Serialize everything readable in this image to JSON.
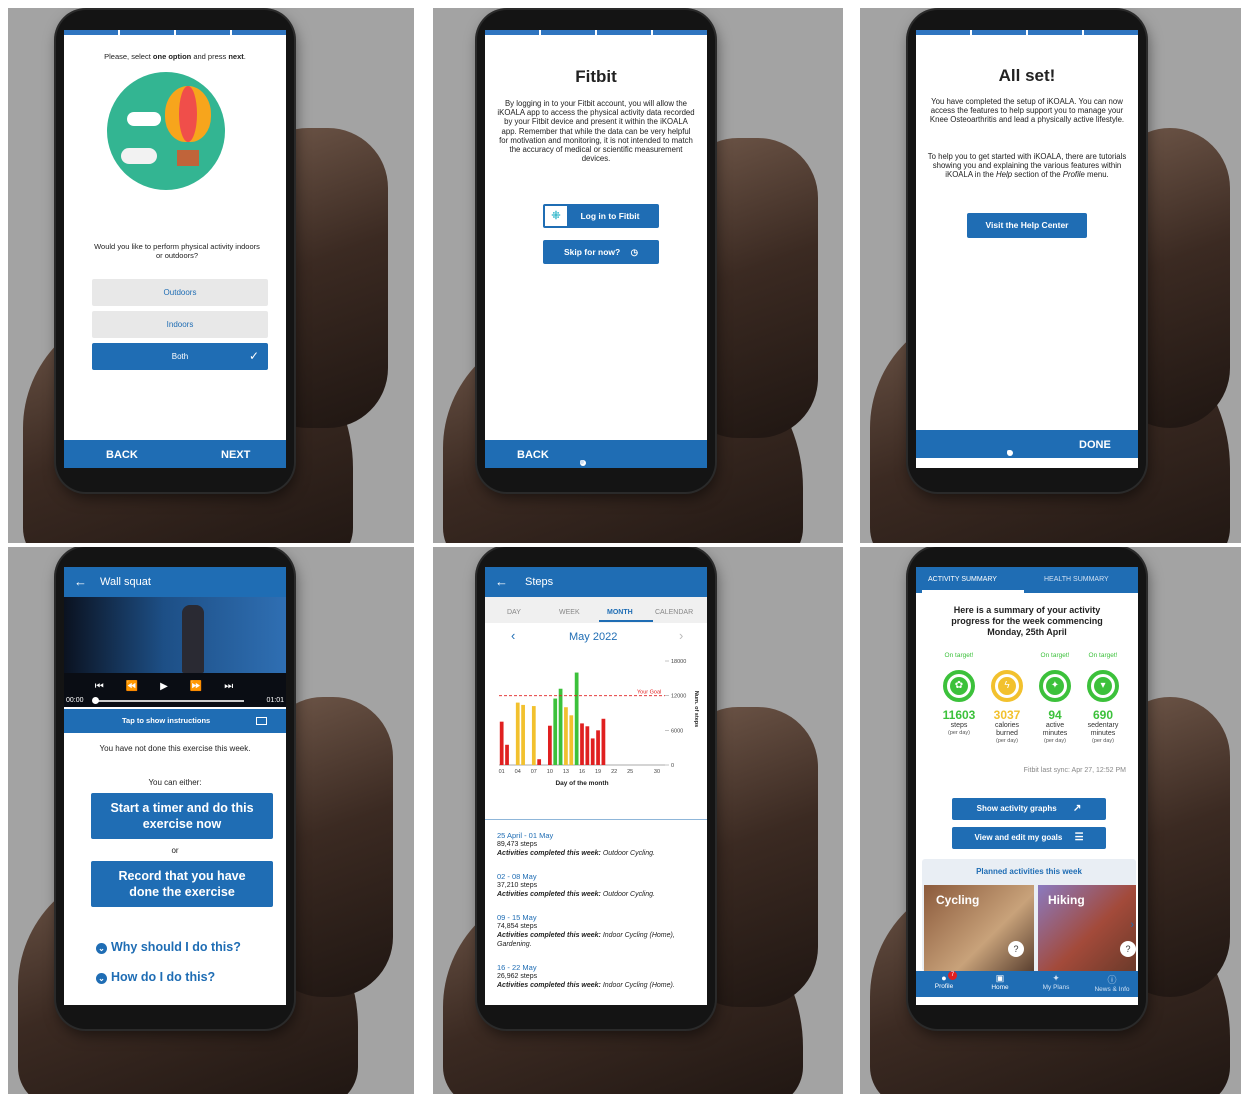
{
  "screen1": {
    "instruction_pre": "Please, select ",
    "instruction_b1": "one option",
    "instruction_mid": " and press ",
    "instruction_b2": "next",
    "instruction_post": ".",
    "question": "Would you like to perform physical activity indoors or outdoors?",
    "options": [
      "Outdoors",
      "Indoors",
      "Both"
    ],
    "selected_check": "✓",
    "back": "BACK",
    "next": "NEXT"
  },
  "screen2": {
    "title": "Fitbit",
    "body": "By logging in to your Fitbit account, you will allow the iKOALA app to access the physical activity data recorded by your Fitbit device and present it within the iKOALA app. Remember that while the data can be very helpful for motivation and monitoring, it is not intended to match the accuracy of medical or scientific measurement devices.",
    "login_button": "Log in to Fitbit",
    "skip_button": "Skip for now?",
    "back": "BACK"
  },
  "screen3": {
    "title": "All set!",
    "para1": "You have completed the setup of iKOALA. You can now access the features to help support you to manage your Knee Osteoarthritis and lead a physically active lifestyle.",
    "para2_a": "To help you to get started with iKOALA, there are tutorials showing you and explaining the various features within iKOALA in the ",
    "para2_help": "Help",
    "para2_b": " section of the ",
    "para2_profile": "Profile",
    "para2_c": " menu.",
    "help_button": "Visit the Help Center",
    "done": "DONE"
  },
  "screen4": {
    "title": "Wall squat",
    "time_start": "00:00",
    "time_end": "01:01",
    "instructions_bar": "Tap to show instructions",
    "not_done": "You have not done this exercise this week.",
    "can_either": "You can either:",
    "btn_timer": "Start a timer and do this exercise now",
    "or": "or",
    "btn_record": "Record that you have done the exercise",
    "why": "Why should I do this?",
    "how": "How do I do this?"
  },
  "screen5": {
    "title": "Steps",
    "tabs": [
      "DAY",
      "WEEK",
      "MONTH",
      "CALENDAR"
    ],
    "active_tab": "MONTH",
    "month": "May 2022",
    "goal_label": "Your Goal",
    "xlabel": "Day of the month",
    "ylabel": "Num. of steps",
    "weeks": [
      {
        "dates": "25 April - 01 May",
        "steps": "89,473 steps",
        "label": "Activities completed this week:",
        "acts": " Outdoor Cycling."
      },
      {
        "dates": "02 - 08 May",
        "steps": "37,210 steps",
        "label": "Activities completed this week:",
        "acts": " Outdoor Cycling."
      },
      {
        "dates": "09 - 15 May",
        "steps": "74,854 steps",
        "label": "Activities completed this week:",
        "acts": " Indoor Cycling (Home), Gardening."
      },
      {
        "dates": "16 - 22 May",
        "steps": "26,962 steps",
        "label": "Activities completed this week:",
        "acts": " Indoor Cycling (Home)."
      }
    ]
  },
  "chart_data": {
    "type": "bar",
    "x": [
      1,
      2,
      3,
      4,
      5,
      6,
      7,
      8,
      9,
      10,
      11,
      12,
      13,
      14,
      15,
      16,
      17,
      18,
      19,
      20,
      21,
      22,
      23,
      24,
      25,
      26,
      27,
      28,
      29,
      30,
      31
    ],
    "values": [
      7500,
      3500,
      0,
      10800,
      10400,
      0,
      10200,
      1000,
      0,
      6800,
      11500,
      13200,
      10000,
      8600,
      16000,
      7200,
      6700,
      4600,
      6000,
      8000,
      0,
      0,
      0,
      0,
      0,
      0,
      0,
      0,
      0,
      0,
      0
    ],
    "colors": [
      "#e02020",
      "#e02020",
      "#e02020",
      "#f2c12e",
      "#f2c12e",
      "#e02020",
      "#f2c12e",
      "#e02020",
      "#e02020",
      "#e02020",
      "#3cc13b",
      "#3cc13b",
      "#f2c12e",
      "#f2c12e",
      "#3cc13b",
      "#e02020",
      "#e02020",
      "#e02020",
      "#e02020",
      "#e02020",
      "#e02020",
      "#e02020",
      "#e02020",
      "#e02020",
      "#e02020",
      "#e02020",
      "#e02020",
      "#e02020",
      "#e02020",
      "#e02020",
      "#e02020"
    ],
    "goal": 12000,
    "ylim": [
      0,
      18000
    ],
    "yticks": [
      0,
      6000,
      12000,
      18000
    ],
    "xticks": [
      1,
      4,
      7,
      10,
      13,
      16,
      19,
      22,
      25,
      30
    ],
    "xtick_labels": [
      "01",
      "04",
      "07",
      "10",
      "13",
      "16",
      "19",
      "22",
      "25",
      "30"
    ],
    "xlabel": "Day of the month",
    "ylabel": "Num. of steps"
  },
  "screen6": {
    "tab_activity": "ACTIVITY SUMMARY",
    "tab_health": "HEALTH SUMMARY",
    "heading": "Here is a summary of your activity progress for the week commencing Monday, 25th April",
    "metrics": [
      {
        "target": "On target!",
        "value": "11603",
        "label": "steps",
        "sub": "(per day)",
        "color": "#3cc13b"
      },
      {
        "target": "",
        "value": "3037",
        "label": "calories burned",
        "sub": "(per day)",
        "color": "#f2c12e"
      },
      {
        "target": "On target!",
        "value": "94",
        "label": "active minutes",
        "sub": "(per day)",
        "color": "#3cc13b"
      },
      {
        "target": "On target!",
        "value": "690",
        "label": "sedentary minutes",
        "sub": "(per day)",
        "color": "#3cc13b"
      }
    ],
    "sync": "Fitbit last sync: Apr 27, 12:52 PM",
    "btn_graphs": "Show activity graphs",
    "btn_goals": "View and edit my goals",
    "planned_title": "Planned activities this week",
    "activities": [
      "Cycling",
      "Hiking"
    ],
    "nav": [
      "Profile",
      "Home",
      "My Plans",
      "News & Info"
    ],
    "profile_badge": "7"
  }
}
